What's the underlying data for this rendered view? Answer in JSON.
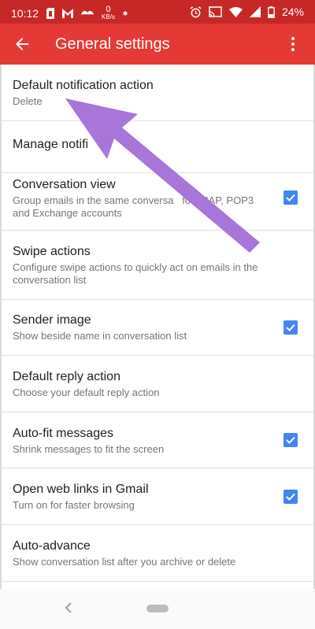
{
  "status_bar": {
    "time": "10:12",
    "speed_value": "0",
    "speed_unit": "KB/s",
    "battery": "24%",
    "icons": [
      "sim-card-icon",
      "gmail-icon",
      "mustache-icon",
      "dot-icon",
      "alarm-icon",
      "cast-icon",
      "wifi-icon",
      "signal-icon",
      "battery-icon"
    ]
  },
  "app_bar": {
    "title": "General settings"
  },
  "settings": [
    {
      "title": "Default notification action",
      "subtitle": "Delete",
      "checkbox": false
    },
    {
      "title": "Manage notifi",
      "subtitle": "",
      "checkbox": false
    },
    {
      "title": "Conversation view",
      "subtitle": "Group emails in the same conversa   for IMAP, POP3 and Exchange accounts",
      "checkbox": true
    },
    {
      "title": "Swipe actions",
      "subtitle": "Configure swipe actions to quickly act on emails in the conversation list",
      "checkbox": false
    },
    {
      "title": "Sender image",
      "subtitle": "Show beside name in conversation list",
      "checkbox": true
    },
    {
      "title": "Default reply action",
      "subtitle": "Choose your default reply action",
      "checkbox": false
    },
    {
      "title": "Auto-fit messages",
      "subtitle": "Shrink messages to fit the screen",
      "checkbox": true
    },
    {
      "title": "Open web links in Gmail",
      "subtitle": "Turn on for faster browsing",
      "checkbox": true
    },
    {
      "title": "Auto-advance",
      "subtitle": "Show conversation list after you archive or delete",
      "checkbox": false
    }
  ],
  "colors": {
    "app_bar": "#e53935",
    "status_bar": "#c62828",
    "checkbox": "#4285f4",
    "annotation_arrow": "#a875d8"
  }
}
